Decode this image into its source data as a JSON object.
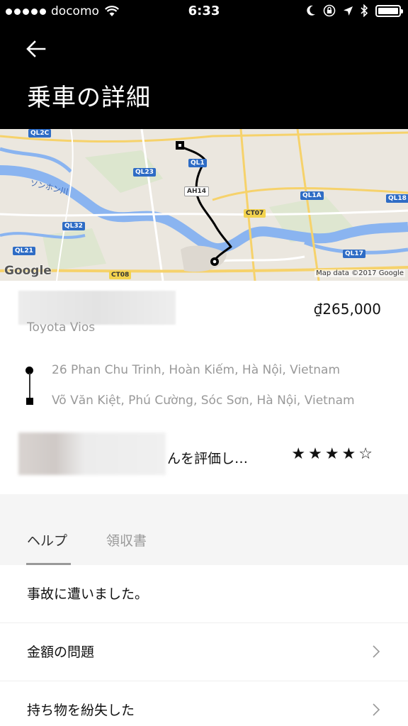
{
  "status_bar": {
    "carrier": "docomo",
    "time": "6:33"
  },
  "header": {
    "title": "乗車の詳細"
  },
  "map": {
    "attribution": "Map data ©2017 Google",
    "logo": "Google",
    "river_label": "ソンホン川",
    "road_labels": [
      "QL2C",
      "QL1",
      "QL23",
      "AH14",
      "QL1A",
      "QL18",
      "CT07",
      "QL32",
      "QL21",
      "QL17",
      "CT08"
    ]
  },
  "trip": {
    "fare": "₫265,000",
    "vehicle": "Toyota Vios",
    "pickup": "26 Phan Chu Trinh, Hoàn Kiếm, Hà Nội, Vietnam",
    "dropoff": "Võ Văn Kiệt, Phú Cường, Sóc Sơn, Hà Nội, Vietnam"
  },
  "rating": {
    "prompt": "んを評価し…",
    "stars_display": "★★★★☆",
    "value": 4,
    "max": 5
  },
  "tabs": [
    {
      "label": "ヘルプ",
      "active": true
    },
    {
      "label": "領収書",
      "active": false
    }
  ],
  "help_items": [
    {
      "label": "事故に遭いました。",
      "chevron": false
    },
    {
      "label": "金額の問題",
      "chevron": true
    },
    {
      "label": "持ち物を紛失した",
      "chevron": true
    }
  ]
}
